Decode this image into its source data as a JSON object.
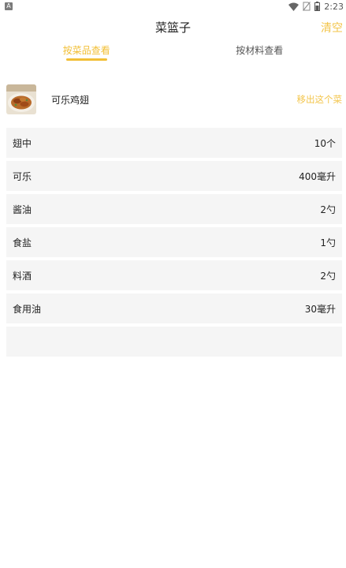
{
  "status_bar": {
    "time": "2:23",
    "app_badge": "A"
  },
  "header": {
    "title": "菜篮子",
    "clear_label": "清空"
  },
  "tabs": [
    {
      "label": "按菜品查看",
      "active": true
    },
    {
      "label": "按材料查看",
      "active": false
    }
  ],
  "dish": {
    "name": "可乐鸡翅",
    "remove_label": "移出这个菜"
  },
  "ingredients": [
    {
      "name": "翅中",
      "amount": "10个"
    },
    {
      "name": "可乐",
      "amount": "400毫升"
    },
    {
      "name": "酱油",
      "amount": "2勺"
    },
    {
      "name": "食盐",
      "amount": "1勺"
    },
    {
      "name": "料酒",
      "amount": "2勺"
    },
    {
      "name": "食用油",
      "amount": "30毫升"
    }
  ],
  "colors": {
    "accent": "#f2bf36",
    "row_bg": "#f5f5f5"
  }
}
